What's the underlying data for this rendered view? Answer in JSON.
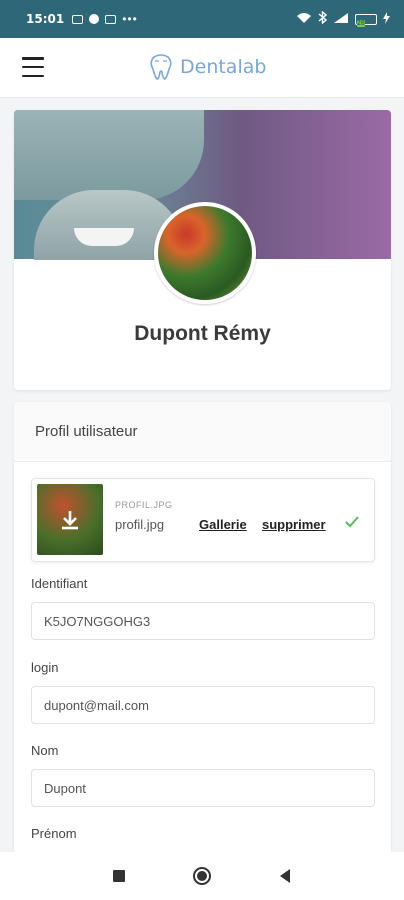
{
  "status": {
    "time": "15:01",
    "battery": "28"
  },
  "app": {
    "brand": "Dentalab"
  },
  "profile": {
    "name": "Dupont Rémy"
  },
  "form": {
    "title": "Profil utilisateur",
    "file": {
      "small_label": "PROFIL.JPG",
      "name": "profil.jpg",
      "gallery_label": "Gallerie",
      "delete_label": "supprimer"
    },
    "fields": [
      {
        "label": "Identifiant",
        "value": "K5JO7NGGOHG3"
      },
      {
        "label": "login",
        "value": "dupont@mail.com"
      },
      {
        "label": "Nom",
        "value": "Dupont"
      },
      {
        "label": "Prénom",
        "value": ""
      }
    ]
  },
  "colors": {
    "status_bar": "#2d6778",
    "brand": "#7aa6d8",
    "check": "#5cb85c"
  },
  "icons": [
    "menu-icon",
    "tooth-logo-icon",
    "download-icon",
    "check-icon",
    "nav-recents-icon",
    "nav-home-icon",
    "nav-back-icon"
  ]
}
